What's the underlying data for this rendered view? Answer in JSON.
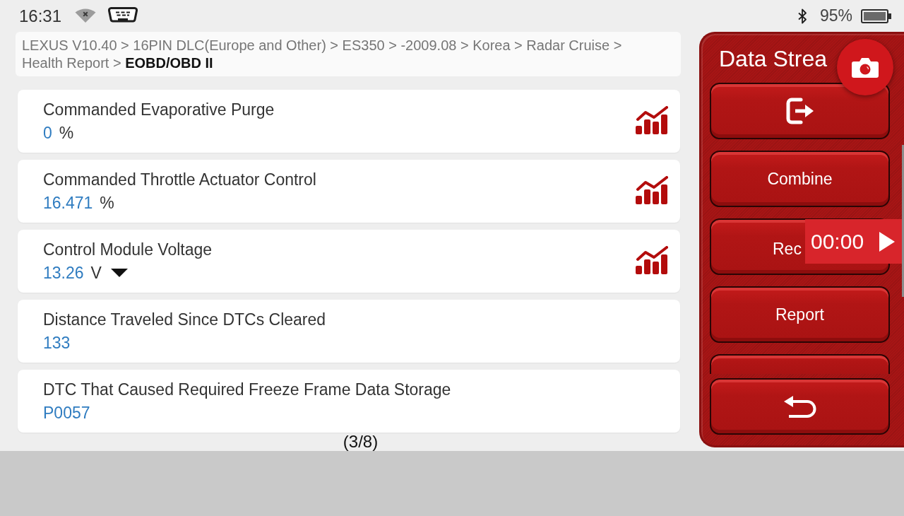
{
  "status_bar": {
    "time": "16:31",
    "battery_percent": "95%"
  },
  "breadcrumb": "LEXUS V10.40 > 16PIN DLC(Europe and Other) > ES350 > -2009.08 > Korea > Radar Cruise > Health Report > **EOBD/OBD II**",
  "rows": [
    {
      "name": "Commanded Evaporative Purge",
      "value": "0",
      "unit": "%",
      "below_range": false,
      "graph": true
    },
    {
      "name": "Commanded Throttle Actuator Control",
      "value": "16.471",
      "unit": "%",
      "below_range": false,
      "graph": true
    },
    {
      "name": "Control Module Voltage",
      "value": "13.26",
      "unit": "V",
      "below_range": true,
      "graph": true
    },
    {
      "name": "Distance Traveled Since DTCs Cleared",
      "value": "133",
      "below_range": false,
      "graph": false
    },
    {
      "name": "DTC That Caused Required Freeze Frame Data Storage",
      "value": "P0057",
      "below_range": false,
      "graph": false
    }
  ],
  "page_indicator": "(3/8)",
  "side_panel": {
    "title": "Data Strea",
    "buttons": [
      {
        "kind": "icon"
      },
      {
        "kind": "text",
        "label": "Combine"
      },
      {
        "kind": "clipped",
        "label": "Rec"
      },
      {
        "kind": "text",
        "label": "Report"
      },
      {
        "kind": "partial"
      }
    ],
    "recording_timer": "00:00"
  }
}
